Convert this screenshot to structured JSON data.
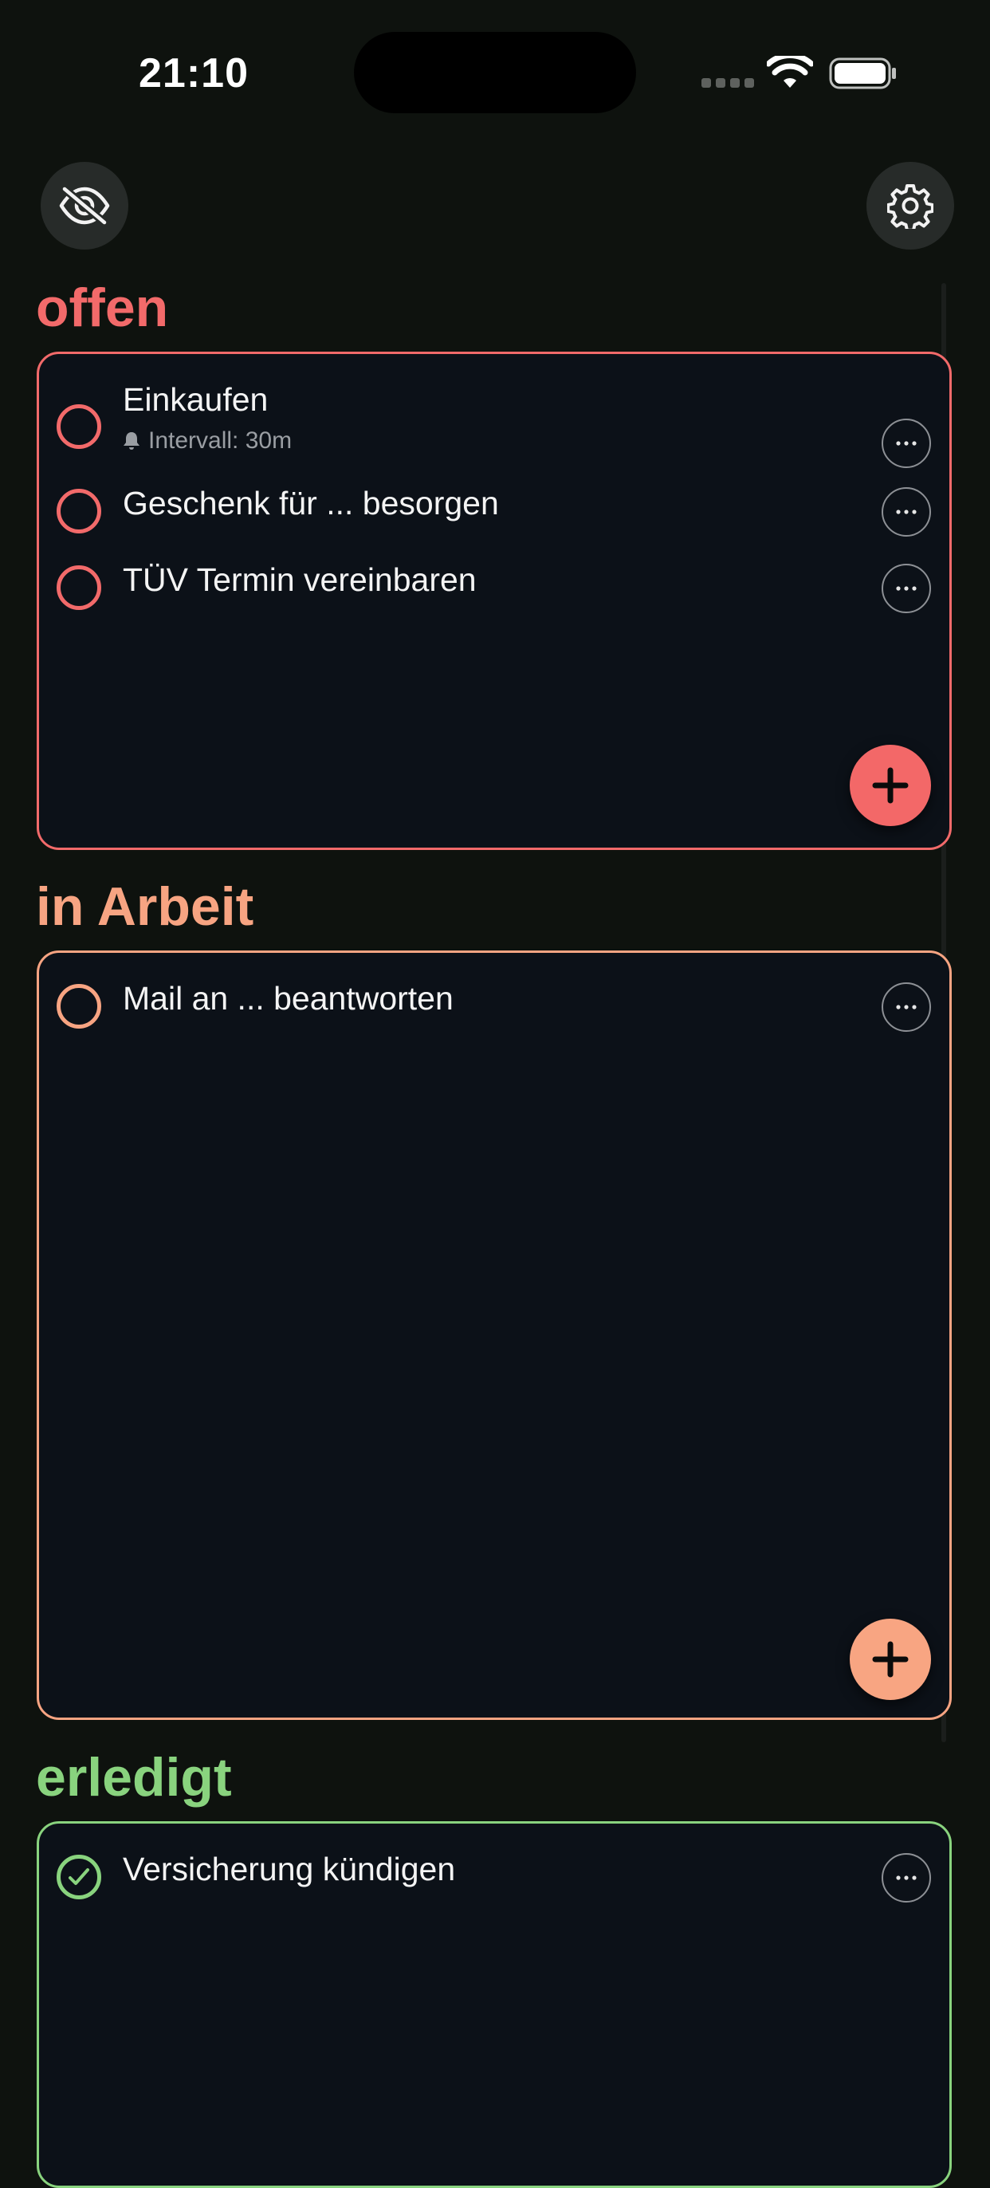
{
  "status_bar": {
    "time": "21:10"
  },
  "toolbar": {
    "visibility_icon": "eye-slash-icon",
    "settings_icon": "gear-icon"
  },
  "colors": {
    "open": "#f26a6a",
    "in_progress": "#f7a482",
    "done": "#89d37e",
    "card_bg": "#0c1118",
    "page_bg": "#0e120e"
  },
  "sections": {
    "open": {
      "title": "offen",
      "tasks": [
        {
          "title": "Einkaufen",
          "reminder": "Intervall: 30m"
        },
        {
          "title": "Geschenk für ... besorgen"
        },
        {
          "title": "TÜV Termin vereinbaren"
        }
      ]
    },
    "in_progress": {
      "title": "in Arbeit",
      "tasks": [
        {
          "title": "Mail an ... beantworten"
        }
      ]
    },
    "done": {
      "title": "erledigt",
      "tasks": [
        {
          "title": "Versicherung kündigen",
          "completed": true
        }
      ]
    }
  }
}
